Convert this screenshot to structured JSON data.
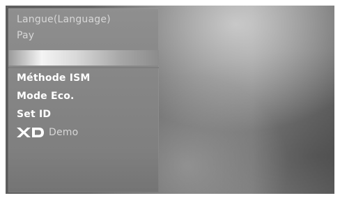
{
  "menu": {
    "items": [
      {
        "label": "Langue(Language)"
      },
      {
        "label": "Pay"
      },
      {
        "label": ""
      },
      {
        "label": "Méthode ISM"
      },
      {
        "label": "Mode Eco."
      },
      {
        "label": "Set ID"
      },
      {
        "label": "Demo",
        "icon": "xd-logo-icon"
      }
    ]
  },
  "colors": {
    "panel": "#868686",
    "text_dim": "#d7d7d7",
    "text_bright": "#ffffff"
  }
}
